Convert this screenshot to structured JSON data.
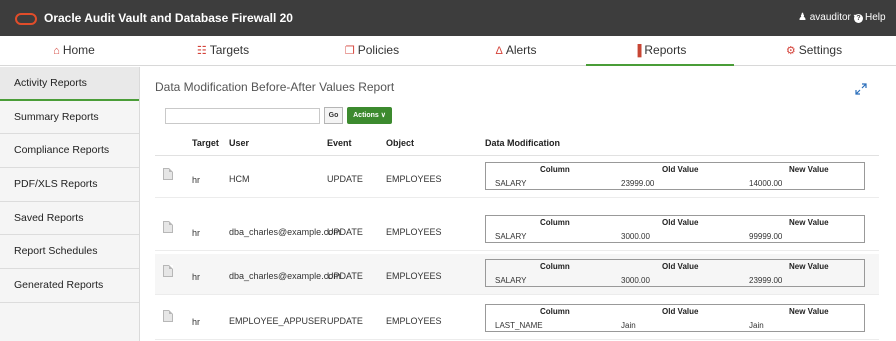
{
  "app": {
    "title": "Oracle Audit Vault and Database Firewall 20"
  },
  "topbar": {
    "user": "avauditor",
    "help": "Help"
  },
  "nav": [
    {
      "label": "Home",
      "icon": "home-icon",
      "glyph": "⌂"
    },
    {
      "label": "Targets",
      "icon": "targets-icon",
      "glyph": "☷"
    },
    {
      "label": "Policies",
      "icon": "policies-icon",
      "glyph": "❐"
    },
    {
      "label": "Alerts",
      "icon": "bell-icon",
      "glyph": "Δ"
    },
    {
      "label": "Reports",
      "icon": "bar-chart-icon",
      "glyph": "▐"
    },
    {
      "label": "Settings",
      "icon": "gear-icon",
      "glyph": "⚙"
    }
  ],
  "sidebar": {
    "items": [
      "Activity Reports",
      "Summary Reports",
      "Compliance Reports",
      "PDF/XLS Reports",
      "Saved Reports",
      "Report Schedules",
      "Generated Reports"
    ]
  },
  "report": {
    "title": "Data Modification Before-After Values Report",
    "search_placeholder": "",
    "go_label": "Go",
    "actions_label": "Actions ∨"
  },
  "table": {
    "headers": {
      "target": "Target",
      "user": "User",
      "event": "Event",
      "object": "Object",
      "data_mod": "Data Modification"
    },
    "dm_headers": {
      "column": "Column",
      "old": "Old Value",
      "new": "New Value"
    },
    "rows": [
      {
        "target": "hr",
        "user": "HCM",
        "event": "UPDATE",
        "object": "EMPLOYEES",
        "column": "SALARY",
        "old": "23999.00",
        "new": "14000.00"
      },
      {
        "target": "hr",
        "user": "dba_charles@example.com",
        "event": "UPDATE",
        "object": "EMPLOYEES",
        "column": "SALARY",
        "old": "3000.00",
        "new": "99999.00"
      },
      {
        "target": "hr",
        "user": "dba_charles@example.com",
        "event": "UPDATE",
        "object": "EMPLOYEES",
        "column": "SALARY",
        "old": "3000.00",
        "new": "23999.00"
      },
      {
        "target": "hr",
        "user": "EMPLOYEE_APPUSER",
        "event": "UPDATE",
        "object": "EMPLOYEES",
        "column": "LAST_NAME",
        "old": "Jain",
        "new": "Jain"
      }
    ]
  },
  "colors": {
    "accent_green": "#4a9d38",
    "actions_green": "#3c8a2e",
    "brand_red": "#c74634",
    "topbar": "#3d3d3d"
  }
}
